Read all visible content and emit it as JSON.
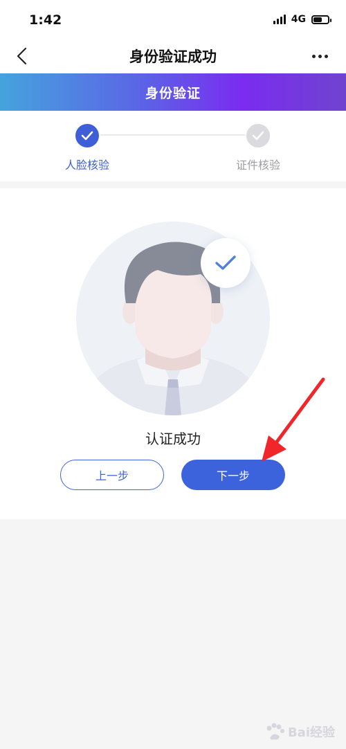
{
  "status_bar": {
    "time": "1:42",
    "network": "4G"
  },
  "nav": {
    "title": "身份验证成功"
  },
  "banner": {
    "title": "身份验证"
  },
  "steps": [
    {
      "label": "人脸核验",
      "state": "done"
    },
    {
      "label": "证件核验",
      "state": "pending"
    }
  ],
  "result": {
    "text": "认证成功"
  },
  "buttons": {
    "prev": "上一步",
    "next": "下一步"
  },
  "watermark": {
    "text": "Bai经验"
  },
  "colors": {
    "accent": "#3f5fd8",
    "arrow": "#f0262a",
    "banner_start": "#45a3dd",
    "banner_end": "#7043d0"
  }
}
